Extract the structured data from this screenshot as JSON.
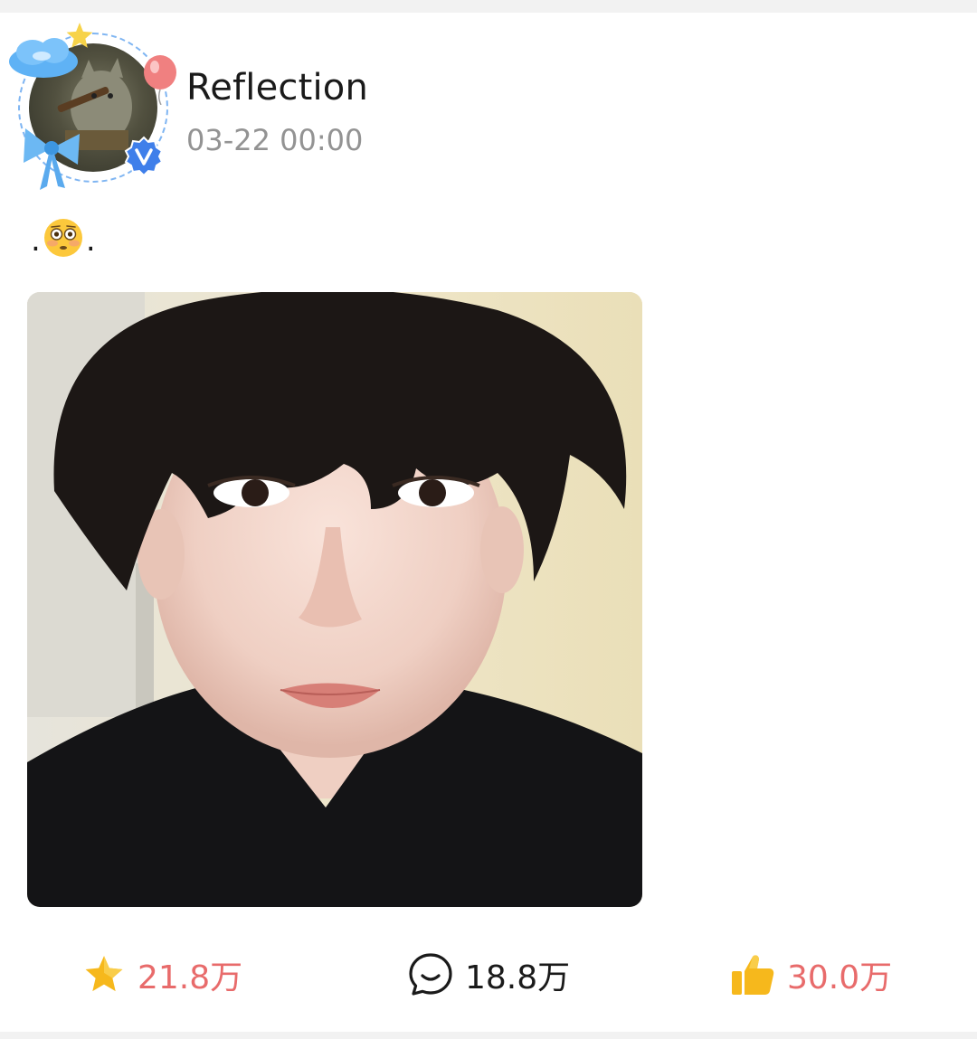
{
  "author": {
    "name": "Reflection",
    "time": "03-22 00:00",
    "verified": true
  },
  "post": {
    "text_prefix": ".",
    "emoji": "flushed-face",
    "text_suffix": "."
  },
  "actions": {
    "repost_count": "21.8万",
    "comment_count": "18.8万",
    "like_count": "30.0万"
  },
  "colors": {
    "count_accent": "#e86b6b",
    "icon_gold": "#f6b81c",
    "verified_blue": "#3f7fea",
    "time_gray": "#939393"
  }
}
